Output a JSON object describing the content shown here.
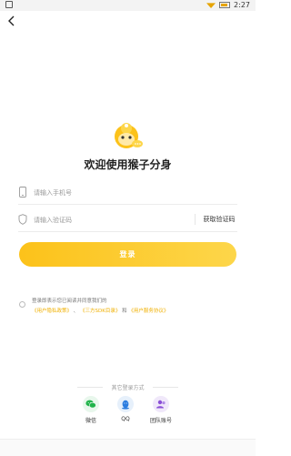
{
  "status_bar": {
    "time": "2:27"
  },
  "header": {
    "back_icon": "chevron-left-icon"
  },
  "brand": {
    "logo_icon": "monkey-logo-icon",
    "title": "欢迎使用猴子分身"
  },
  "form": {
    "phone": {
      "placeholder": "请输入手机号",
      "value": "",
      "icon": "phone-icon"
    },
    "code": {
      "placeholder": "请输入验证码",
      "value": "",
      "icon": "shield-icon",
      "get_code_label": "获取验证码"
    }
  },
  "login_button": {
    "label": "登录",
    "color_start": "#fcc21a",
    "color_end": "#fdd64a"
  },
  "agreement": {
    "text": "登录即表示您已阅读并同意我们的",
    "links": [
      "《用户隐私政策》",
      "《三方SDK目录》",
      "《用户服务协议》"
    ],
    "sep1": "、",
    "sep2": "和"
  },
  "other_login": {
    "title": "其它登录方式",
    "options": [
      {
        "label": "微信",
        "icon": "wechat-icon",
        "color": "#20b34a",
        "bg": "#e8f7ec"
      },
      {
        "label": "QQ",
        "icon": "qq-icon",
        "color": "#2b7de0",
        "bg": "#e6f0fb"
      },
      {
        "label": "团队账号",
        "icon": "team-icon",
        "color": "#8a4fd6",
        "bg": "#f0e8fa"
      }
    ]
  },
  "colors": {
    "accent": "#fcc21a",
    "link": "#f0b000"
  }
}
